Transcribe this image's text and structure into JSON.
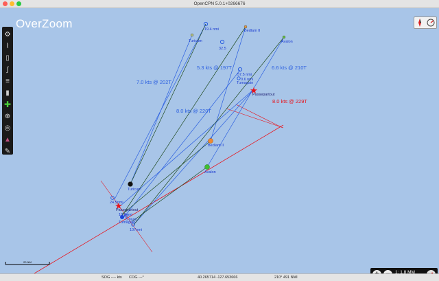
{
  "window": {
    "title": "OpenCPN 5.0.1+0266676"
  },
  "overlay": {
    "mode_label": "OverZoom"
  },
  "targets": [
    {
      "name": "Turicum",
      "vector_label": "7.0 kts @ 202T",
      "range_label": "19.4 nmi"
    },
    {
      "name": "Bedlam II",
      "vector_label": "8.0 kts @ 220T",
      "range_label": "32.5"
    },
    {
      "name": "Avalon",
      "vector_label": "6.6 kts @ 210T",
      "range_label": ""
    },
    {
      "name": "Passepartout",
      "vector_label": "8.0 kts @ 229T",
      "range_label": ""
    },
    {
      "name": "Tumagain",
      "vector_label": "5.3 kts @ 197T",
      "range_label": "57.5 nmi",
      "range_label_2": "0.6 nmi"
    }
  ],
  "lower_labels": {
    "turicum": "Turicum",
    "bedlam": "Bedlam II",
    "avalon": "Avalon",
    "passepartout": "Passepartout",
    "tumagain": "Tumagain",
    "r1": "24.5nmi",
    "r2": "18.8nmi",
    "r3": "6.9nmi",
    "r4": "107nmi"
  },
  "scale": {
    "label": "20 NM"
  },
  "zoom": {
    "level": "1: 1.8 MM"
  },
  "status": {
    "sog": "SOG ---- kts",
    "cog": "COG ---°",
    "position": "40.265714   -127.653666",
    "bearing": "210° 491 NMI"
  },
  "colors": {
    "sea": "#a8c5e8",
    "ais": "#2b5fe0",
    "track": "#1f4a1f",
    "own": "#e8131b"
  }
}
